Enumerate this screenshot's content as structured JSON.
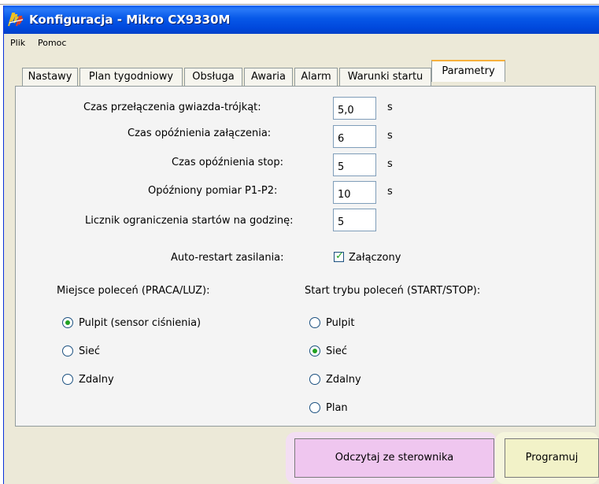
{
  "window": {
    "title": "Konfiguracja - Mikro CX9330M"
  },
  "menu": {
    "items": [
      "Plik",
      "Pomoc"
    ]
  },
  "tabs": [
    {
      "label": "Nastawy"
    },
    {
      "label": "Plan tygodniowy"
    },
    {
      "label": "Obsługa"
    },
    {
      "label": "Awaria"
    },
    {
      "label": "Alarm"
    },
    {
      "label": "Warunki startu"
    },
    {
      "label": "Parametry",
      "active": true
    }
  ],
  "params": [
    {
      "label": "Czas przełączenia gwiazda-trójkąt:",
      "value": "5,0",
      "unit": "s"
    },
    {
      "label": "Czas opóźnienia załączenia:",
      "value": "6",
      "unit": "s"
    },
    {
      "label": "Czas opóźnienia stop:",
      "value": "5",
      "unit": "s"
    },
    {
      "label": "Opóźniony pomiar P1-P2:",
      "value": "10",
      "unit": "s"
    },
    {
      "label": "Licznik ograniczenia startów na godzinę:",
      "value": "5"
    }
  ],
  "auto_restart": {
    "label": "Auto-restart zasilania:",
    "checkbox_label": "Załączony",
    "checked": true
  },
  "command_place": {
    "title": "Miejsce poleceń (PRACA/LUZ):",
    "options": [
      "Pulpit (sensor ciśnienia)",
      "Sieć",
      "Zdalny"
    ],
    "selected": "Pulpit (sensor ciśnienia)"
  },
  "command_start": {
    "title": "Start trybu poleceń (START/STOP):",
    "options": [
      "Pulpit",
      "Sieć",
      "Zdalny",
      "Plan"
    ],
    "selected": "Sieć"
  },
  "buttons": {
    "read": "Odczytaj ze sterownika",
    "program": "Programuj"
  },
  "colors": {
    "titlebar": "#0758e8",
    "read_button": "#efc6ef",
    "program_button": "#f2f2c8",
    "radio_selected": "#21a121"
  }
}
